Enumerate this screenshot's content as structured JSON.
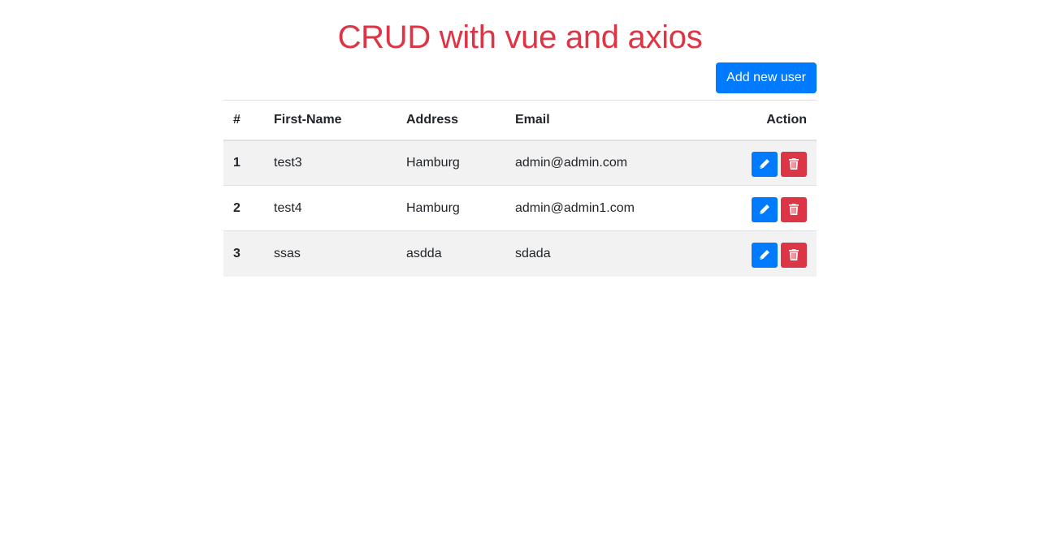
{
  "header": {
    "title": "CRUD with vue and axios",
    "add_button_label": "Add new user"
  },
  "table": {
    "columns": {
      "num": "#",
      "first_name": "First-Name",
      "address": "Address",
      "email": "Email",
      "action": "Action"
    },
    "rows": [
      {
        "num": "1",
        "first_name": "test3",
        "address": "Hamburg",
        "email": "admin@admin.com"
      },
      {
        "num": "2",
        "first_name": "test4",
        "address": "Hamburg",
        "email": "admin@admin1.com"
      },
      {
        "num": "3",
        "first_name": "ssas",
        "address": "asdda",
        "email": "sdada"
      }
    ]
  },
  "icons": {
    "edit": "pencil-icon",
    "delete": "trash-icon"
  },
  "colors": {
    "title": "#dc3545",
    "primary": "#007bff",
    "danger": "#dc3545",
    "stripe": "#f2f2f2"
  }
}
